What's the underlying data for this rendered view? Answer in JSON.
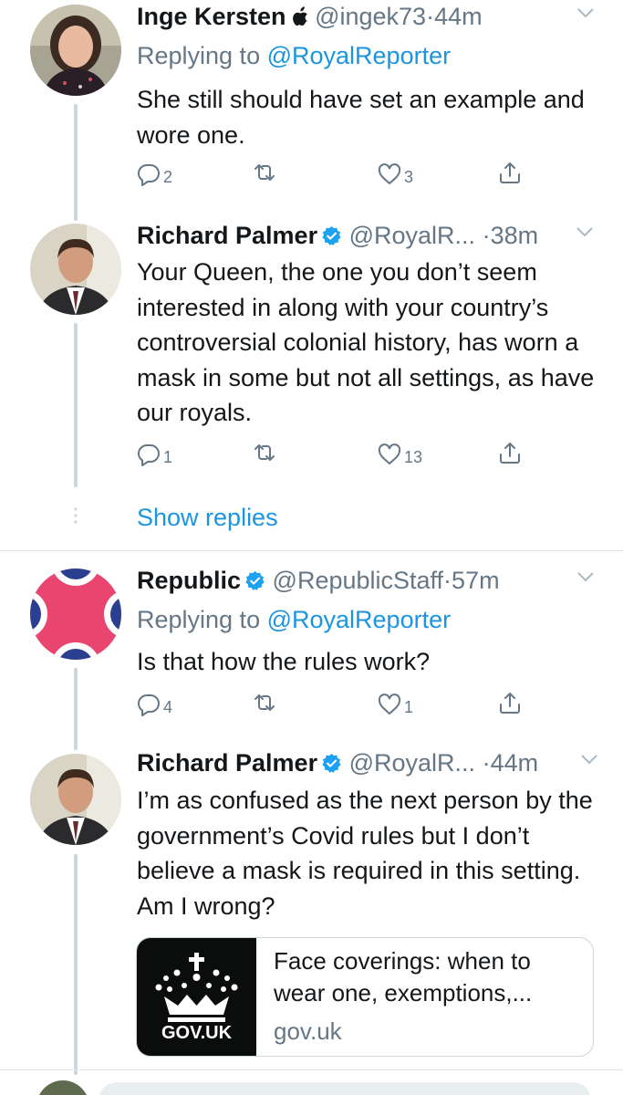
{
  "tweets": [
    {
      "name": "Inge Kersten",
      "handle": "@ingek73",
      "dot": "·",
      "time": "44m",
      "replying_prefix": "Replying to",
      "replying_to": "@RoyalReporter",
      "text": "She still should have set an example and wore one.",
      "replies": "2",
      "likes": "3"
    },
    {
      "name": "Richard Palmer",
      "handle": "@RoyalR...",
      "dot": "·",
      "time": "38m",
      "text": "Your Queen, the one you don’t seem interested in along with your country’s controversial colonial history, has worn a mask in some but not all settings, as have our royals.",
      "replies": "1",
      "likes": "13"
    },
    {
      "name": "Republic",
      "handle": "@RepublicStaff",
      "dot": "·",
      "time": "57m",
      "replying_prefix": "Replying to",
      "replying_to": "@RoyalReporter",
      "text": "Is that how the rules work?",
      "replies": "4",
      "likes": "1"
    },
    {
      "name": "Richard Palmer",
      "handle": "@RoyalR...",
      "dot": "·",
      "time": "44m",
      "text": "I’m as confused as the next person by the government’s Covid rules but I don’t believe a mask is required in this setting. Am I wrong?"
    }
  ],
  "show_replies": "Show replies",
  "link_card": {
    "title": "Face coverings: when to wear one, exemptions,...",
    "domain": "gov.uk",
    "image_text": "GOV.UK"
  },
  "colors": {
    "link_blue": "#1b95e0",
    "muted_gray": "#657786",
    "verified_blue": "#1da1f2",
    "thread_line": "#cdd5dd"
  }
}
